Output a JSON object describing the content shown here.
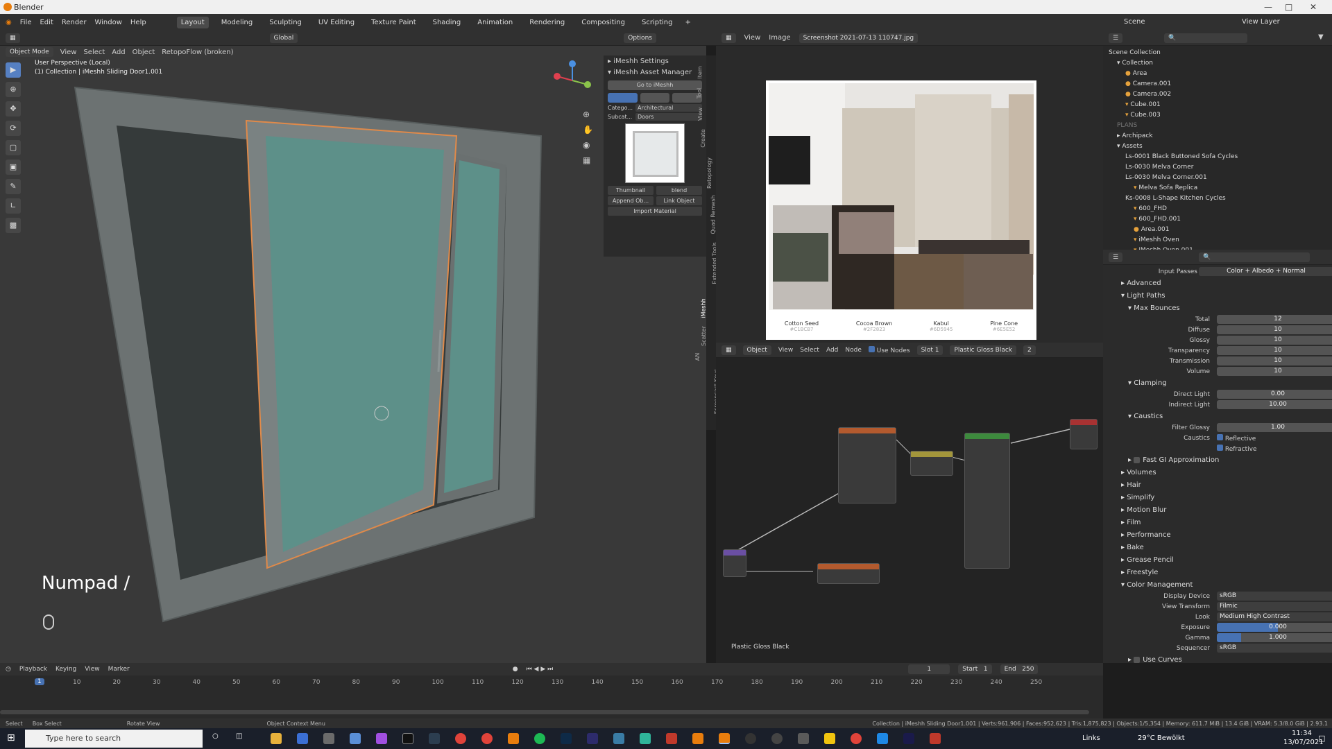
{
  "window": {
    "title": "Blender"
  },
  "menu": [
    "File",
    "Edit",
    "Render",
    "Window",
    "Help"
  ],
  "workspaces": [
    "Layout",
    "Modeling",
    "Sculpting",
    "UV Editing",
    "Texture Paint",
    "Shading",
    "Animation",
    "Rendering",
    "Compositing",
    "Scripting"
  ],
  "viewport_header": {
    "transform": "Global",
    "options": "Options"
  },
  "viewport_header2": {
    "mode": "Object Mode",
    "view": "View",
    "select": "Select",
    "add": "Add",
    "object": "Object",
    "retopo": "RetopoFlow (broken)"
  },
  "viewport": {
    "perspective": "User Perspective (Local)",
    "collection": "(1) Collection | iMeshh Sliding Door1.001",
    "key_overlay": "Numpad /"
  },
  "npanel": {
    "settings": "iMeshh Settings",
    "asset_manager": "iMeshh Asset Manager",
    "goto": "Go to iMeshh",
    "category_label": "Catego...",
    "category_value": "Architectural",
    "subcat_label": "Subcat...",
    "subcat_value": "Doors",
    "thumbnail": "Thumbnail",
    "blend": "blend",
    "append": "Append Ob...",
    "link": "Link Object",
    "import": "Import Material"
  },
  "vtabs": [
    "Item",
    "Tool",
    "View",
    "Create",
    "Retopology",
    "Quad Remesh",
    "Extended Tools",
    "iMeshh",
    "Scatter",
    "AN",
    "Screencast Keys"
  ],
  "image_editor": {
    "view": "View",
    "image": "Image",
    "filename": "Screenshot 2021-07-13 110747.jpg"
  },
  "swatches": [
    {
      "name": "Cotton Seed",
      "code": "#C1BCB7",
      "color": "#c1bcb7"
    },
    {
      "name": "Cocoa Brown",
      "code": "#2F2823",
      "color": "#2f2823"
    },
    {
      "name": "Kabul",
      "code": "#6D5945",
      "color": "#6d5945"
    },
    {
      "name": "Pine Cone",
      "code": "#6E5E52",
      "color": "#6e5e52"
    }
  ],
  "node_header": {
    "object": "Object",
    "view": "View",
    "select": "Select",
    "add": "Add",
    "node": "Node",
    "use_nodes": "Use Nodes",
    "slot": "Slot 1",
    "material": "Plastic Gloss Black",
    "users": "2"
  },
  "node_editor": {
    "material_label": "Plastic Gloss Black"
  },
  "outliner": {
    "scene": "Scene",
    "view_layer": "View Layer",
    "items": [
      {
        "label": "Scene Collection",
        "indent": 0
      },
      {
        "label": "Collection",
        "indent": 1
      },
      {
        "label": "Area",
        "indent": 2
      },
      {
        "label": "Camera.001",
        "indent": 2
      },
      {
        "label": "Camera.002",
        "indent": 2
      },
      {
        "label": "Cube.001",
        "indent": 2
      },
      {
        "label": "Cube.003",
        "indent": 2
      },
      {
        "label": "PLANS",
        "indent": 1
      },
      {
        "label": "Archipack",
        "indent": 1
      },
      {
        "label": "Assets",
        "indent": 1
      },
      {
        "label": "Ls-0001 Black Buttoned Sofa Cycles",
        "indent": 2
      },
      {
        "label": "Ls-0030 Melva Corner",
        "indent": 2
      },
      {
        "label": "Ls-0030 Melva Corner.001",
        "indent": 2
      },
      {
        "label": "Melva Sofa Replica",
        "indent": 3
      },
      {
        "label": "Ks-0008 L-Shape Kitchen Cycles",
        "indent": 2
      },
      {
        "label": "600_FHD",
        "indent": 3
      },
      {
        "label": "600_FHD.001",
        "indent": 3
      },
      {
        "label": "Area.001",
        "indent": 3
      },
      {
        "label": "iMeshh Oven",
        "indent": 3
      },
      {
        "label": "iMeshh Oven.001",
        "indent": 3
      }
    ]
  },
  "properties": {
    "input_passes_label": "Input Passes",
    "input_passes_value": "Color + Albedo + Normal",
    "advanced": "Advanced",
    "light_paths": "Light Paths",
    "max_bounces": "Max Bounces",
    "bounces": [
      {
        "label": "Total",
        "value": "12"
      },
      {
        "label": "Diffuse",
        "value": "10"
      },
      {
        "label": "Glossy",
        "value": "10"
      },
      {
        "label": "Transparency",
        "value": "10"
      },
      {
        "label": "Transmission",
        "value": "10"
      },
      {
        "label": "Volume",
        "value": "10"
      }
    ],
    "clamping": "Clamping",
    "direct_light_label": "Direct Light",
    "direct_light": "0.00",
    "indirect_light_label": "Indirect Light",
    "indirect_light": "10.00",
    "caustics": "Caustics",
    "filter_glossy_label": "Filter Glossy",
    "filter_glossy": "1.00",
    "caustics_label": "Caustics",
    "reflective": "Reflective",
    "refractive": "Refractive",
    "fast_gi": "Fast GI Approximation",
    "sections": [
      "Volumes",
      "Hair",
      "Simplify",
      "Motion Blur",
      "Film",
      "Performance",
      "Bake",
      "Grease Pencil",
      "Freestyle"
    ],
    "color_management": "Color Management",
    "display_device_label": "Display Device",
    "display_device": "sRGB",
    "view_transform_label": "View Transform",
    "view_transform": "Filmic",
    "look_label": "Look",
    "look": "Medium High Contrast",
    "exposure_label": "Exposure",
    "exposure": "0.000",
    "gamma_label": "Gamma",
    "gamma": "1.000",
    "sequencer_label": "Sequencer",
    "sequencer": "sRGB",
    "use_curves": "Use Curves"
  },
  "timeline": {
    "playback": "Playback",
    "keying": "Keying",
    "view": "View",
    "marker": "Marker",
    "current": "1",
    "start_label": "Start",
    "start": "1",
    "end_label": "End",
    "end": "250",
    "ticks": [
      "10",
      "20",
      "30",
      "40",
      "50",
      "60",
      "70",
      "80",
      "90",
      "100",
      "110",
      "120",
      "130",
      "140",
      "150",
      "160",
      "170",
      "180",
      "190",
      "200",
      "210",
      "220",
      "230",
      "240",
      "250"
    ]
  },
  "statusbar": {
    "select": "Select",
    "box_select": "Box Select",
    "rotate": "Rotate View",
    "context": "Object Context Menu",
    "stats": "Collection | iMeshh Sliding Door1.001 | Verts:961,906 | Faces:952,623 | Tris:1,875,823 | Objects:1/5,354 | Memory: 611.7 MiB | 13.4 GiB | VRAM: 5.3/8.0 GiB | 2.93.1"
  },
  "taskbar": {
    "search": "Type here to search",
    "links": "Links",
    "weather": "29°C Bewölkt",
    "time": "11:34",
    "date": "13/07/2021"
  }
}
